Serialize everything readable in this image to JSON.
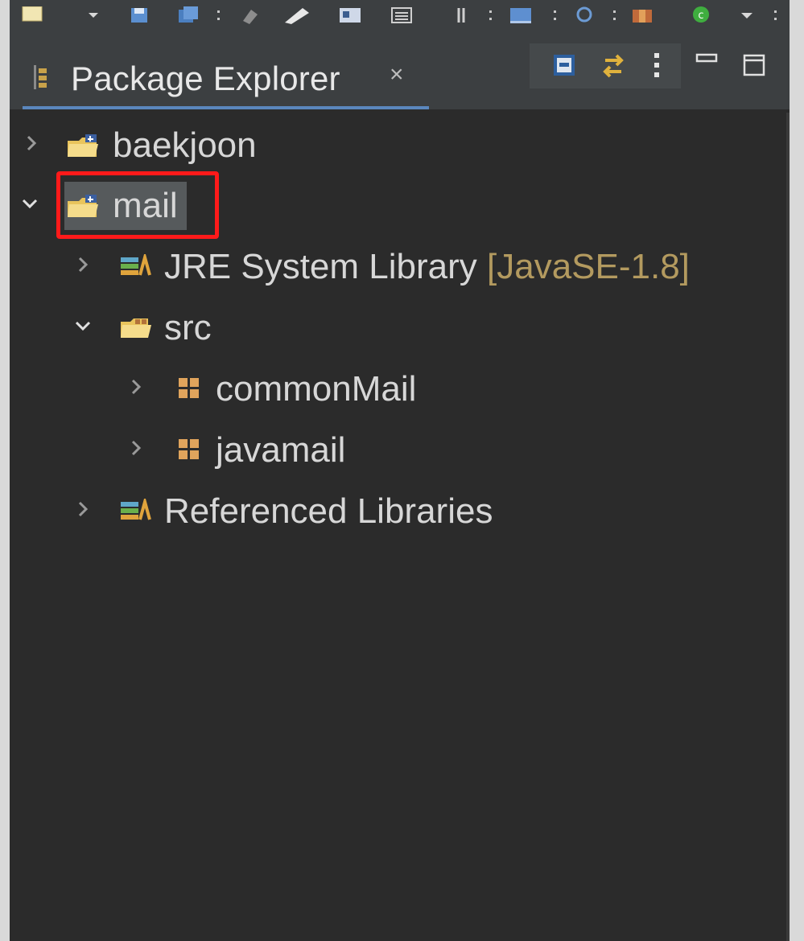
{
  "view": {
    "title": "Package Explorer",
    "close_glyph": "×"
  },
  "tree": {
    "items": [
      {
        "label": "baekjoon",
        "icon": "java-project-icon",
        "expanded": false,
        "depth": 0
      },
      {
        "label": "mail",
        "icon": "java-project-icon",
        "expanded": true,
        "depth": 0,
        "selected": true
      },
      {
        "label": "JRE System Library",
        "decoration": "[JavaSE-1.8]",
        "icon": "library-icon",
        "expanded": false,
        "depth": 1
      },
      {
        "label": "src",
        "icon": "source-folder-icon",
        "expanded": true,
        "depth": 1
      },
      {
        "label": "commonMail",
        "icon": "package-icon",
        "expanded": false,
        "depth": 2
      },
      {
        "label": "javamail",
        "icon": "package-icon",
        "expanded": false,
        "depth": 2
      },
      {
        "label": "Referenced Libraries",
        "icon": "library-icon",
        "expanded": false,
        "depth": 1
      }
    ]
  },
  "colors": {
    "background": "#2b2b2b",
    "header": "#3c3f41",
    "text": "#d7d7d7",
    "decoration": "#b39a5f",
    "selection": "#565a5c",
    "highlight_box": "#ff1a1a",
    "tab_accent": "#5a87bd"
  }
}
